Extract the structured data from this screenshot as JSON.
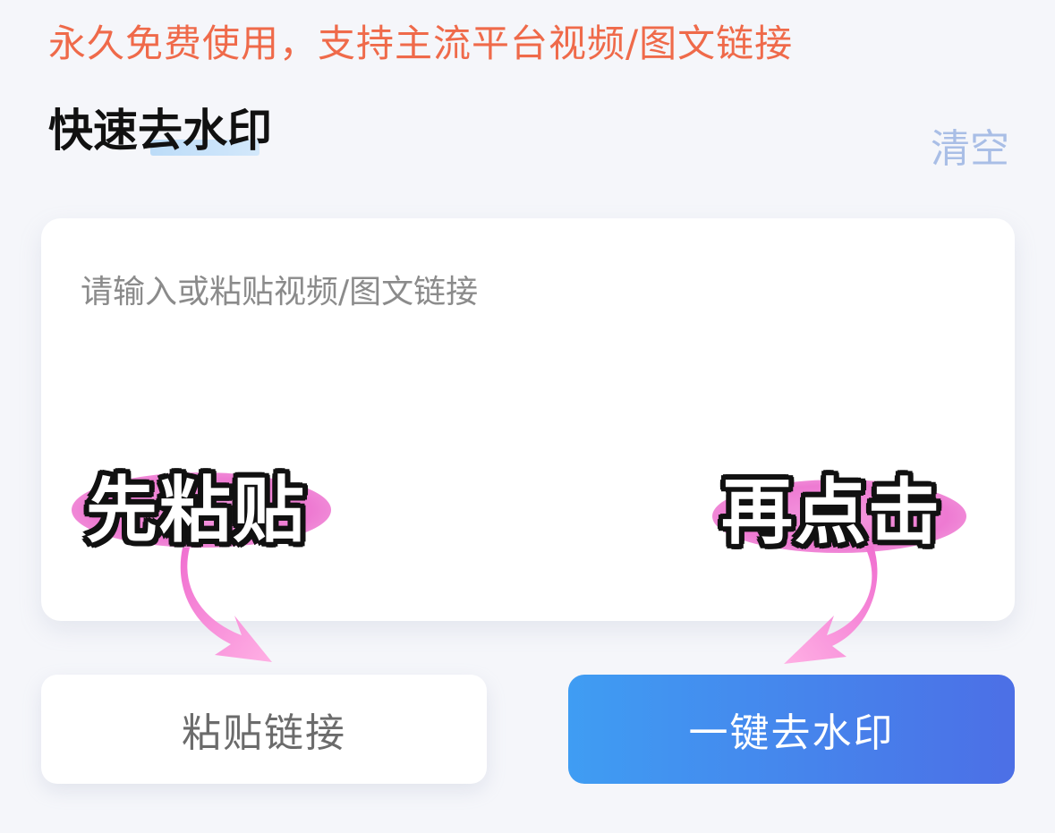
{
  "promo_text": "永久免费使用，支持主流平台视频/图文链接",
  "header": {
    "title": "快速去水印",
    "clear_label": "清空"
  },
  "input": {
    "value": "",
    "placeholder": "请输入或粘贴视频/图文链接"
  },
  "annotations": {
    "step1": "先粘贴",
    "step2": "再点击"
  },
  "buttons": {
    "paste_label": "粘贴链接",
    "remove_label": "一键去水印"
  },
  "colors": {
    "promo": "#ef6a4a",
    "clear": "#a9bee6",
    "accent_gradient_start": "#3f9df3",
    "accent_gradient_end": "#4c6fe6",
    "annotation_pink": "#ee7ad2"
  },
  "icons": {
    "step1_arrow": "curved-arrow-down-right-icon",
    "step2_arrow": "curved-arrow-down-left-icon"
  }
}
